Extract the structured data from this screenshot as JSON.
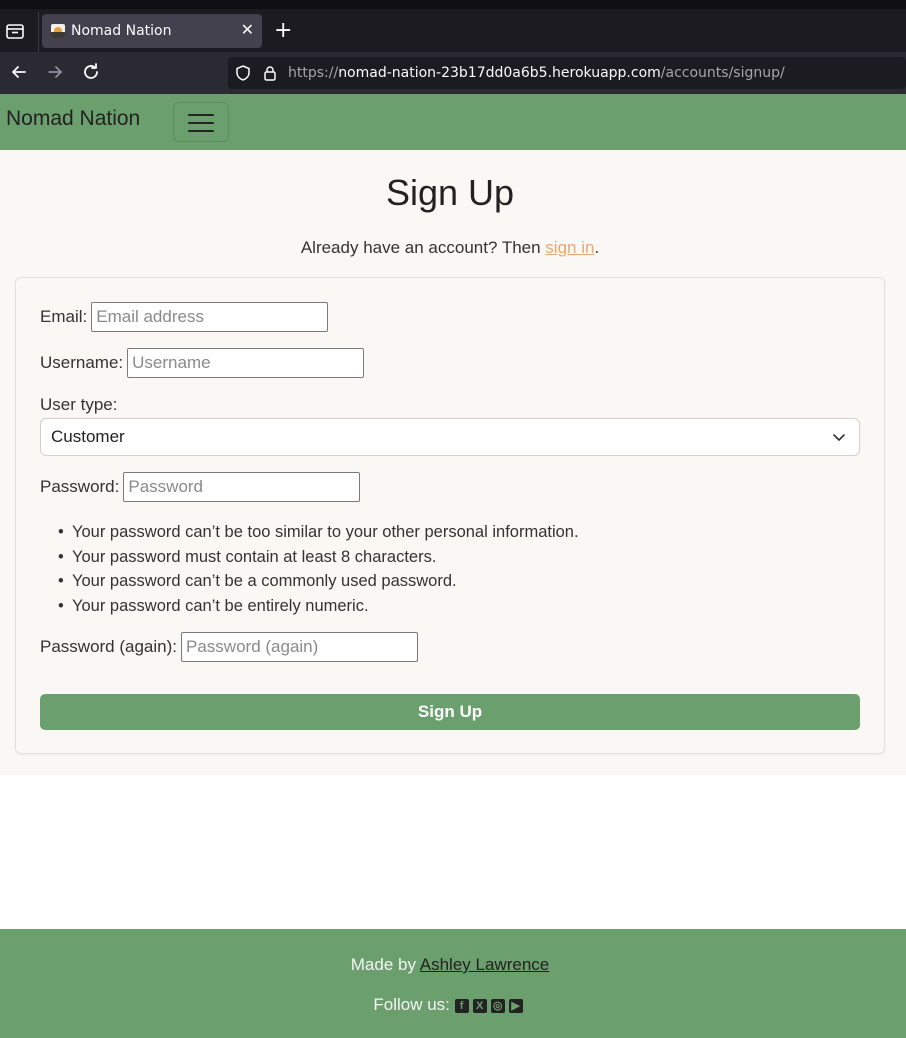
{
  "browser": {
    "tab_title": "Nomad Nation",
    "url_prefix": "https://",
    "url_host": "nomad-nation-23b17dd0a6b5.herokuapp.com",
    "url_path": "/accounts/signup/"
  },
  "site": {
    "brand": "Nomad Nation",
    "accent_color": "#6c9f6e",
    "link_color": "#e9a873"
  },
  "signup": {
    "title": "Sign Up",
    "lead_text": "Already have an account? Then ",
    "lead_link": "sign in",
    "lead_end": ".",
    "email_label": "Email:",
    "email_placeholder": "Email address",
    "username_label": "Username:",
    "username_placeholder": "Username",
    "usertype_label": "User type:",
    "usertype_value": "Customer",
    "password_label": "Password:",
    "password_placeholder": "Password",
    "password_help": [
      "Your password can’t be too similar to your other personal information.",
      "Your password must contain at least 8 characters.",
      "Your password can’t be a commonly used password.",
      "Your password can’t be entirely numeric."
    ],
    "password2_label": "Password (again):",
    "password2_placeholder": "Password (again)",
    "submit_label": "Sign Up"
  },
  "footer": {
    "made_by": "Made by ",
    "author": "Ashley Lawrence",
    "follow": "Follow us:",
    "social_icons": [
      "facebook-icon",
      "x-icon",
      "instagram-icon",
      "youtube-icon"
    ]
  }
}
